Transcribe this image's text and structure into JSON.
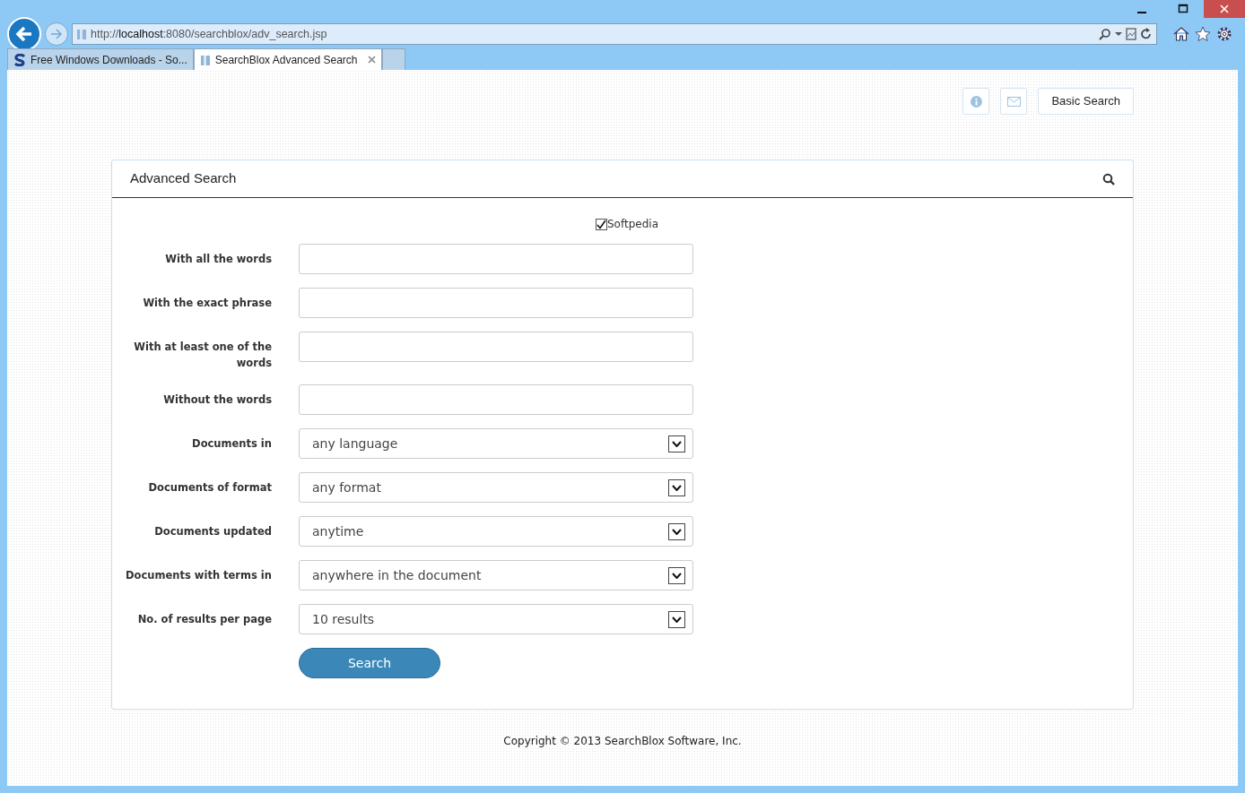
{
  "browser": {
    "address": "http://**localhost**:8080/searchblox/adv_search.jsp",
    "tabs": [
      {
        "label": "Free Windows Downloads - So...",
        "selected": false,
        "closable": false
      },
      {
        "label": "SearchBlox Advanced Search",
        "selected": true,
        "closable": true
      }
    ]
  },
  "toolbar": {
    "buttons": [
      {
        "kind": "info"
      },
      {
        "kind": "mail"
      },
      {
        "kind": "text",
        "label": "Basic Search"
      }
    ]
  },
  "panel": {
    "title": "Advanced Search",
    "collection": {
      "label": "Softpedia",
      "checked": true
    },
    "fields": [
      {
        "label": "With all the words",
        "kind": "text"
      },
      {
        "label": "With the exact phrase",
        "kind": "text"
      },
      {
        "label": "With at least one of the words",
        "kind": "text"
      },
      {
        "label": "Without the words",
        "kind": "text"
      },
      {
        "label": "Documents in",
        "kind": "select",
        "value": "any language"
      },
      {
        "label": "Documents of format",
        "kind": "select",
        "value": "any format"
      },
      {
        "label": "Documents updated",
        "kind": "select",
        "value": "anytime"
      },
      {
        "label": "Documents with terms in",
        "kind": "select",
        "value": "anywhere in the document"
      },
      {
        "label": "No. of results per page",
        "kind": "select",
        "value": "10 results"
      }
    ],
    "submit": "Search"
  },
  "footer": "Copyright © 2013 SearchBlox Software, Inc."
}
